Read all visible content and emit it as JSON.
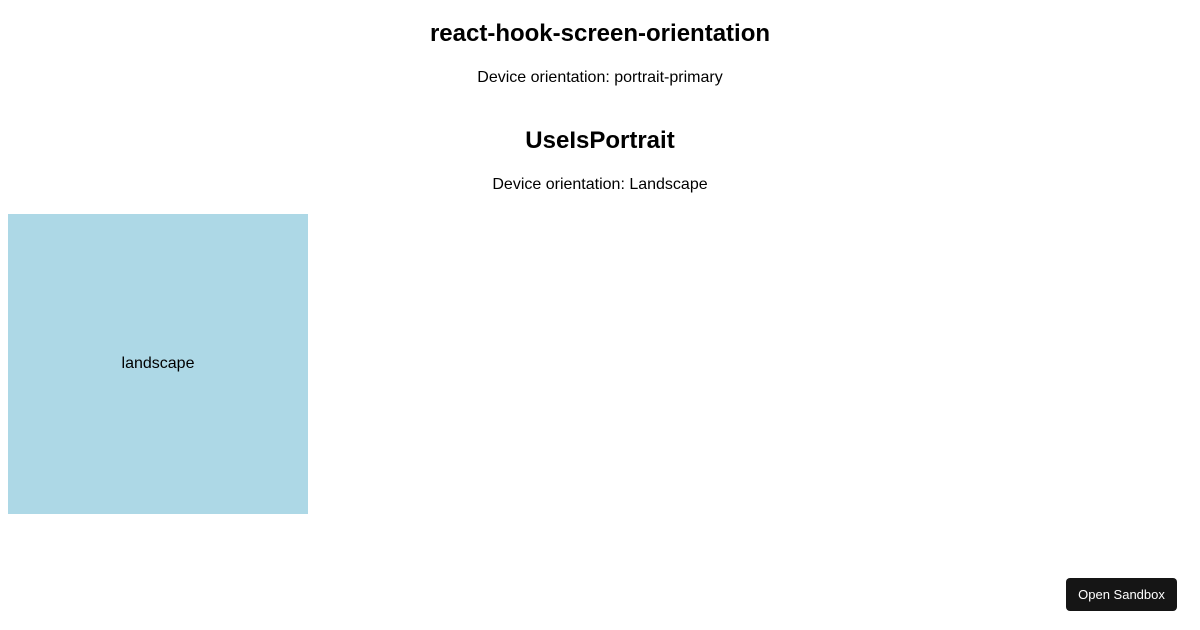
{
  "header": {
    "title": "react-hook-screen-orientation",
    "orientation_text": "Device orientation: portrait-primary"
  },
  "section": {
    "title": "UseIsPortrait",
    "orientation_text": "Device orientation: Landscape"
  },
  "box": {
    "label": "landscape",
    "color": "#ADD8E6"
  },
  "button": {
    "label": "Open Sandbox",
    "color": "#151515"
  }
}
